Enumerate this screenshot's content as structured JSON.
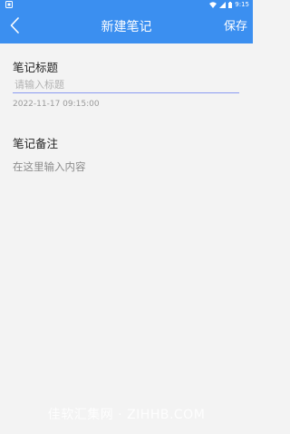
{
  "status_bar": {
    "time": "9:15"
  },
  "header": {
    "title": "新建笔记",
    "save_label": "保存"
  },
  "form": {
    "title_label": "笔记标题",
    "title_placeholder": "请输入标题",
    "timestamp": "2022-11-17 09:15:00",
    "note_label": "笔记备注",
    "note_placeholder": "在这里输入内容"
  },
  "watermark": "佳软汇集网 · ZIHHB.COM",
  "colors": {
    "accent": "#3b8ff0",
    "input_underline": "#8a9bf2",
    "background": "#f3f3f3"
  }
}
